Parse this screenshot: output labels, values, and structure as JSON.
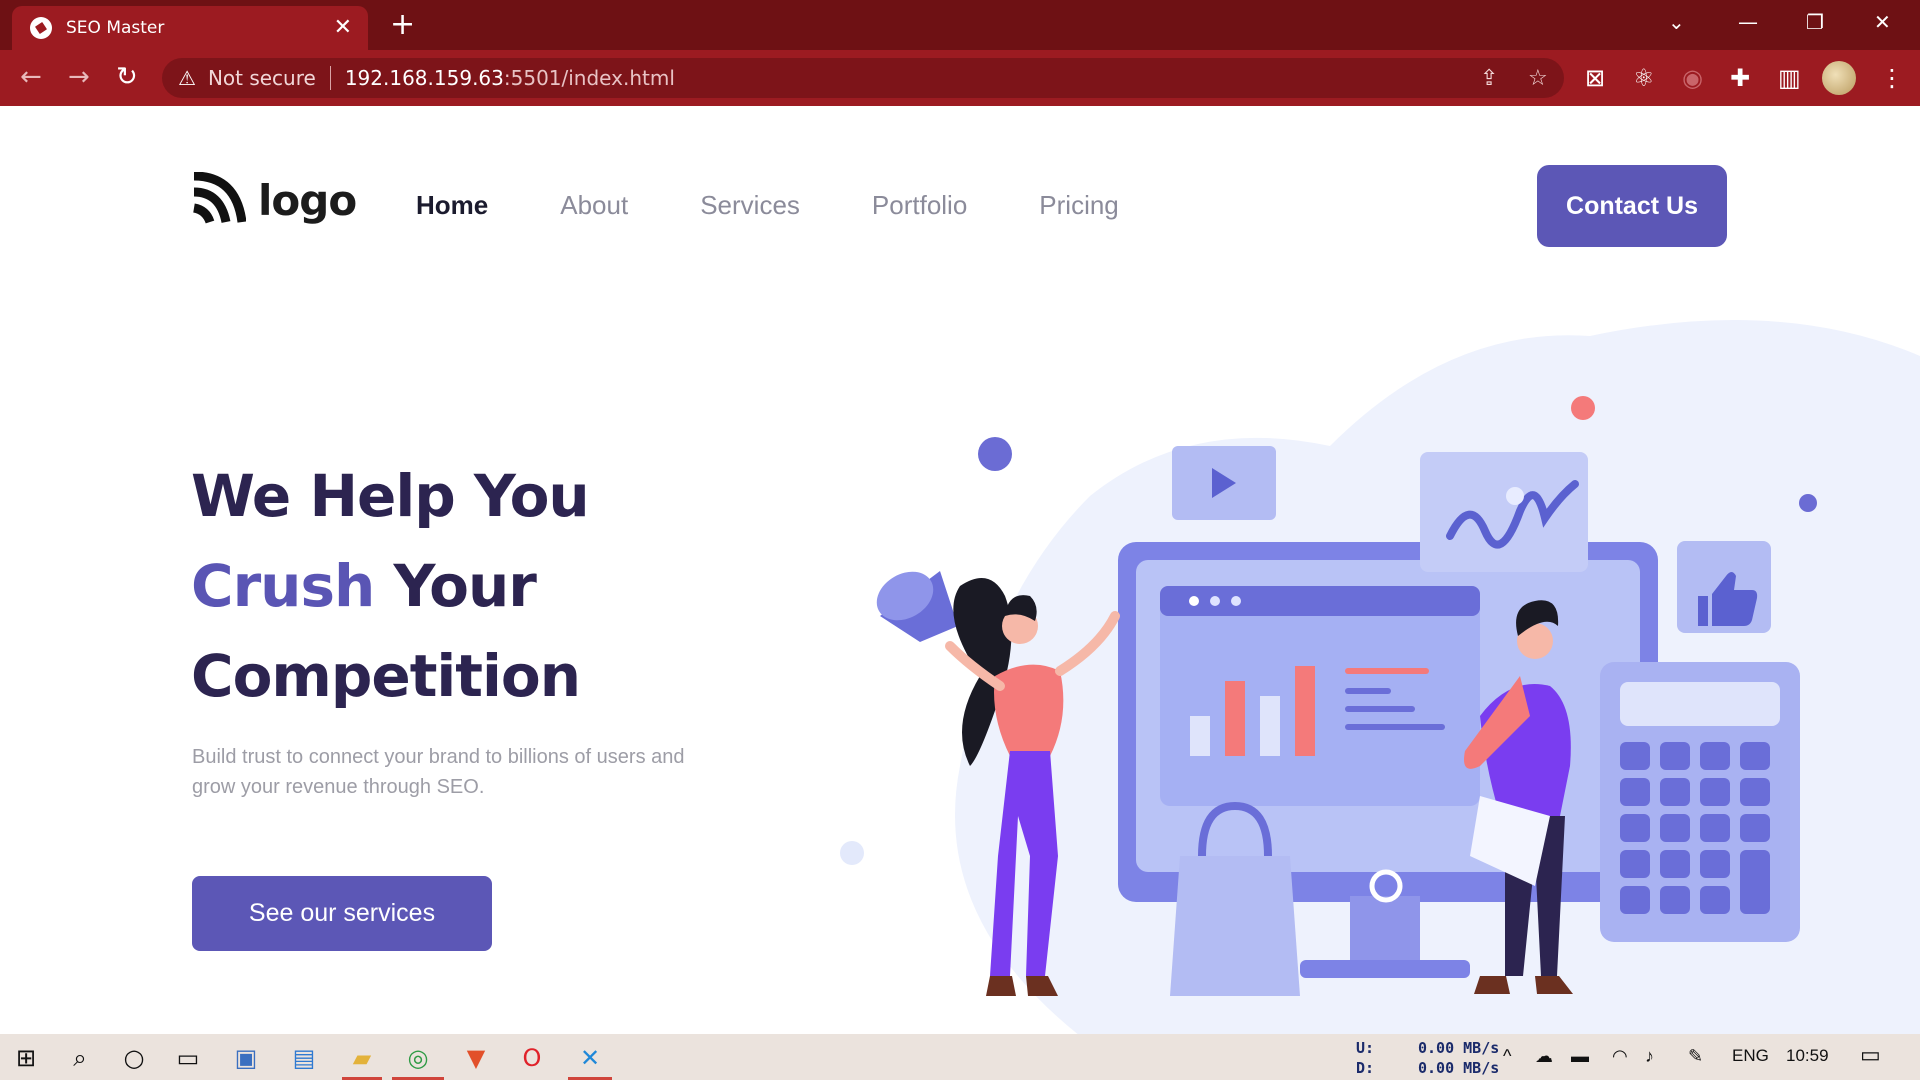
{
  "browser": {
    "tab_title": "SEO Master",
    "tab_close": "✕",
    "new_tab": "+",
    "not_secure": "Not secure",
    "url_host": "192.168.159.63",
    "url_path": ":5501/index.html"
  },
  "site": {
    "logo_text": "logo",
    "nav": [
      "Home",
      "About",
      "Services",
      "Portfolio",
      "Pricing"
    ],
    "active_nav": "Home",
    "contact_label": "Contact Us",
    "hero_line1": "We Help You",
    "hero_accent": "Crush",
    "hero_line2_rest": " Your",
    "hero_line3": "Competition",
    "hero_sub": "Build trust to connect your brand to billions of users and grow your revenue through SEO.",
    "cta_label": "See our services",
    "accent_color": "#5c57b6",
    "heading_color": "#2c2450"
  },
  "taskbar": {
    "upload_label": "U:",
    "download_label": "D:",
    "upload_rate": "0.00 MB/s",
    "download_rate": "0.00 MB/s",
    "language": "ENG",
    "time": "10:59"
  }
}
